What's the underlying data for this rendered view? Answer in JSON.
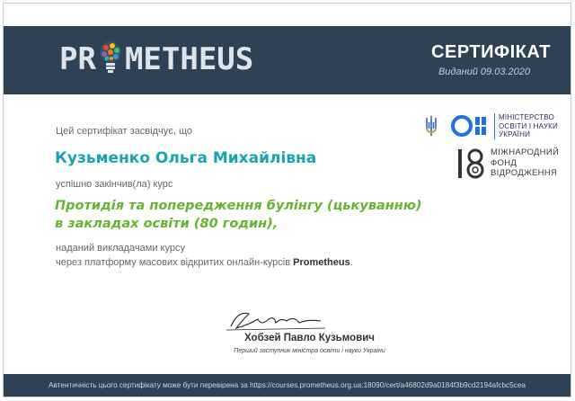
{
  "header": {
    "brand": "PROMETHEUS",
    "brand_prefix": "PR",
    "brand_suffix": "METHEUS",
    "cert_title": "СЕРТИФІКАТ",
    "issued": "Виданий 09.03.2020"
  },
  "body": {
    "certifies": "Цей сертифікат засвідчує, що",
    "name": "Кузьменко Ольга Михайлівна",
    "completed": "успішно закінчив(ла) курс",
    "course_line1": "Протидія та попередження булінгу (цькуванню)",
    "course_line2": "в закладах освіти (80 годин),",
    "given_line1": "наданий викладачами курсу",
    "given_line2_prefix": "через платформу масових відкритих онлайн-курсів ",
    "given_line2_brand": "Prometheus",
    "given_line2_suffix": "."
  },
  "signatory": {
    "name": "Хобзей Павло Кузьмович",
    "title": "Перший заступник міністра освіти і науки України"
  },
  "logos": {
    "ministry": [
      "МІНІСТЕРСТВО",
      "ОСВІТИ І НАУКИ",
      "УКРАЇНИ"
    ],
    "foundation": [
      "МІЖНАРОДНИЙ",
      "ФОНД",
      "ВІДРОДЖЕННЯ"
    ]
  },
  "footer": {
    "text": "Автентичність цього сертифікату може бути перевірена за https://courses.prometheus.org.ua:18090/cert/a46802d9a0184f3b9cd2194afcbc5cea"
  },
  "colors": {
    "header_bg": "#2f4154",
    "name": "#1aa3b5",
    "course": "#63b531",
    "ministry_blue": "#1f6fe5"
  },
  "icons": [
    "lightbulb-logo-icon",
    "trident-icon",
    "ministry-logo-icon",
    "irf-logo-icon",
    "signature-icon"
  ]
}
